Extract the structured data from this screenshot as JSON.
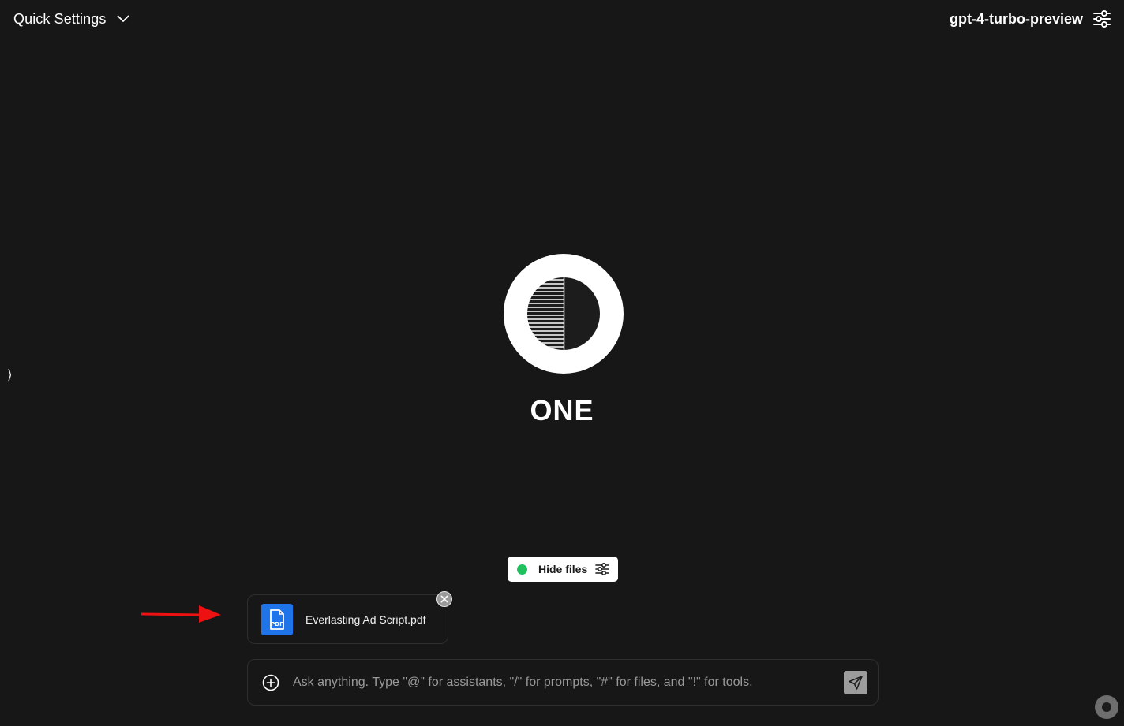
{
  "header": {
    "quick_settings_label": "Quick Settings",
    "quick_settings_icon": "chevron-down-icon",
    "model_name": "gpt-4-turbo-preview",
    "model_settings_icon": "sliders-icon"
  },
  "sidebar": {
    "toggle_glyph": "⟩"
  },
  "hero": {
    "brand_name": "ONE"
  },
  "files": {
    "toggle_label": "Hide files",
    "toggle_status_color": "#1fc15d",
    "attached": [
      {
        "name": "Everlasting Ad Script.pdf",
        "type_badge": "PDF",
        "icon_color": "#1e74e8"
      }
    ]
  },
  "composer": {
    "placeholder": "Ask anything. Type \"@\" for assistants, \"/\" for prompts, \"#\" for files, and \"!\" for tools.",
    "value": ""
  },
  "annotation": {
    "arrow_color": "#ee1111"
  }
}
